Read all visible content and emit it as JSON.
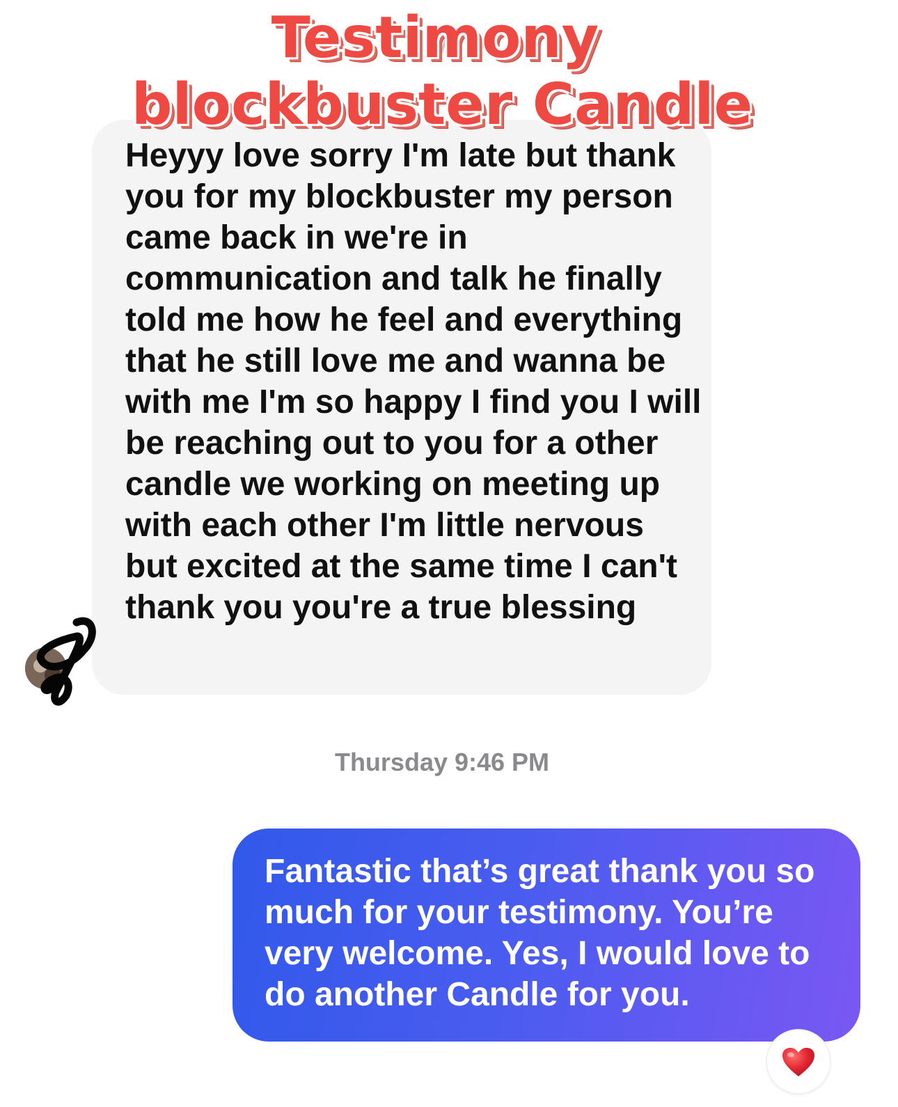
{
  "overlay": {
    "title_line_1": "Testimony",
    "title_line_2": "blockbuster Candle"
  },
  "messages": {
    "incoming": {
      "text": "Heyyy love sorry I'm late but thank you for my blockbuster my person came back in we're in communication and talk he finally told me how he feel and everything that he still love me and wanna be with me I'm so happy I find you I will be reaching out to you for a other candle we working on meeting up with each other I'm little nervous but excited at the same time I can't thank you you're a true blessing"
    },
    "timestamp": "Thursday 9:46 PM",
    "outgoing": {
      "text": "Fantastic that’s great thank you so much for your testimony. You’re very welcome. Yes, I would love to do another Candle for you.",
      "reaction": "red-heart-icon"
    }
  },
  "colors": {
    "overlay_red": "#ee4a43",
    "incoming_bubble": "#f4f4f5",
    "outgoing_gradient_start": "#3159ea",
    "outgoing_gradient_end": "#7a57f3",
    "timestamp_gray": "#8a8a8e",
    "heart": "#e0242f"
  }
}
